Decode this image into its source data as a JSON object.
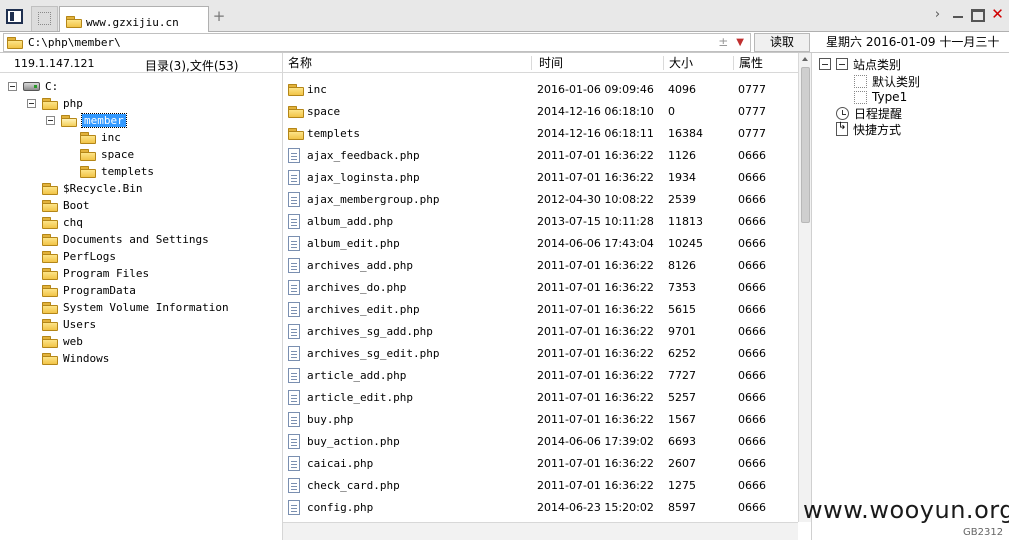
{
  "tab": {
    "title": "www.gzxijiu.cn"
  },
  "address": {
    "path": "C:\\php\\member\\",
    "read_button": "读取"
  },
  "date": {
    "text": "星期六 2016-01-09 十一月三十"
  },
  "status": {
    "ip": "119.1.147.121",
    "counts": "目录(3),文件(53)"
  },
  "tree": [
    {
      "label": "C:",
      "kind": "drive",
      "expander": true
    },
    {
      "label": "php",
      "kind": "folder",
      "expander": true
    },
    {
      "label": "member",
      "kind": "folder-open",
      "expander": true,
      "selected": true
    },
    {
      "label": "inc",
      "kind": "folder"
    },
    {
      "label": "space",
      "kind": "folder"
    },
    {
      "label": "templets",
      "kind": "folder"
    },
    {
      "label": "$Recycle.Bin",
      "kind": "folder"
    },
    {
      "label": "Boot",
      "kind": "folder"
    },
    {
      "label": "chq",
      "kind": "folder"
    },
    {
      "label": "Documents and Settings",
      "kind": "folder"
    },
    {
      "label": "PerfLogs",
      "kind": "folder"
    },
    {
      "label": "Program Files",
      "kind": "folder"
    },
    {
      "label": "ProgramData",
      "kind": "folder"
    },
    {
      "label": "System Volume Information",
      "kind": "folder"
    },
    {
      "label": "Users",
      "kind": "folder"
    },
    {
      "label": "web",
      "kind": "folder"
    },
    {
      "label": "Windows",
      "kind": "folder"
    }
  ],
  "columns": {
    "name": "名称",
    "time": "时间",
    "size": "大小",
    "attr": "属性"
  },
  "files": [
    {
      "name": "inc",
      "type": "folder",
      "time": "2016-01-06 09:09:46",
      "size": "4096",
      "attr": "0777"
    },
    {
      "name": "space",
      "type": "folder",
      "time": "2014-12-16 06:18:10",
      "size": "0",
      "attr": "0777"
    },
    {
      "name": "templets",
      "type": "folder",
      "time": "2014-12-16 06:18:11",
      "size": "16384",
      "attr": "0777"
    },
    {
      "name": "ajax_feedback.php",
      "type": "file",
      "time": "2011-07-01 16:36:22",
      "size": "1126",
      "attr": "0666"
    },
    {
      "name": "ajax_loginsta.php",
      "type": "file",
      "time": "2011-07-01 16:36:22",
      "size": "1934",
      "attr": "0666"
    },
    {
      "name": "ajax_membergroup.php",
      "type": "file",
      "time": "2012-04-30 10:08:22",
      "size": "2539",
      "attr": "0666"
    },
    {
      "name": "album_add.php",
      "type": "file",
      "time": "2013-07-15 10:11:28",
      "size": "11813",
      "attr": "0666"
    },
    {
      "name": "album_edit.php",
      "type": "file",
      "time": "2014-06-06 17:43:04",
      "size": "10245",
      "attr": "0666"
    },
    {
      "name": "archives_add.php",
      "type": "file",
      "time": "2011-07-01 16:36:22",
      "size": "8126",
      "attr": "0666"
    },
    {
      "name": "archives_do.php",
      "type": "file",
      "time": "2011-07-01 16:36:22",
      "size": "7353",
      "attr": "0666"
    },
    {
      "name": "archives_edit.php",
      "type": "file",
      "time": "2011-07-01 16:36:22",
      "size": "5615",
      "attr": "0666"
    },
    {
      "name": "archives_sg_add.php",
      "type": "file",
      "time": "2011-07-01 16:36:22",
      "size": "9701",
      "attr": "0666"
    },
    {
      "name": "archives_sg_edit.php",
      "type": "file",
      "time": "2011-07-01 16:36:22",
      "size": "6252",
      "attr": "0666"
    },
    {
      "name": "article_add.php",
      "type": "file",
      "time": "2011-07-01 16:36:22",
      "size": "7727",
      "attr": "0666"
    },
    {
      "name": "article_edit.php",
      "type": "file",
      "time": "2011-07-01 16:36:22",
      "size": "5257",
      "attr": "0666"
    },
    {
      "name": "buy.php",
      "type": "file",
      "time": "2011-07-01 16:36:22",
      "size": "1567",
      "attr": "0666"
    },
    {
      "name": "buy_action.php",
      "type": "file",
      "time": "2014-06-06 17:39:02",
      "size": "6693",
      "attr": "0666"
    },
    {
      "name": "caicai.php",
      "type": "file",
      "time": "2011-07-01 16:36:22",
      "size": "2607",
      "attr": "0666"
    },
    {
      "name": "check_card.php",
      "type": "file",
      "time": "2011-07-01 16:36:22",
      "size": "1275",
      "attr": "0666"
    },
    {
      "name": "config.php",
      "type": "file",
      "time": "2014-06-23 15:20:02",
      "size": "8597",
      "attr": "0666"
    }
  ],
  "right_panel": {
    "site_category": "站点类别",
    "categories": [
      "默认类别",
      "Type1"
    ],
    "reminder": "日程提醒",
    "shortcut": "快捷方式"
  },
  "watermark": {
    "text": "www.wooyun.org",
    "code": "GB2312"
  }
}
